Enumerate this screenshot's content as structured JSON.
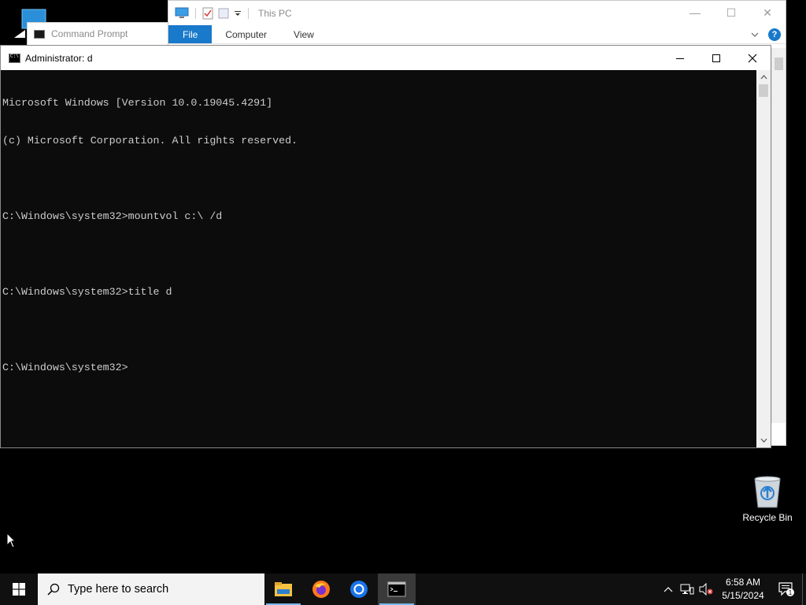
{
  "desktop": {
    "recycle_bin_label": "Recycle Bin"
  },
  "background_cmd": {
    "title": "Command Prompt"
  },
  "explorer": {
    "title": "This PC",
    "tabs": [
      "File",
      "Computer",
      "View"
    ],
    "accent": "#1979ca"
  },
  "cmd": {
    "title": "Administrator:  d",
    "lines": [
      "Microsoft Windows [Version 10.0.19045.4291]",
      "(c) Microsoft Corporation. All rights reserved.",
      "",
      "C:\\Windows\\system32>mountvol c:\\ /d",
      "",
      "C:\\Windows\\system32>title d",
      "",
      "C:\\Windows\\system32>"
    ],
    "text_color": "#cccccc",
    "background": "#0c0c0c"
  },
  "taskbar": {
    "search_placeholder": "Type here to search",
    "apps": [
      "file-explorer",
      "firefox",
      "chrome",
      "command-prompt"
    ],
    "clock_time": "6:58 AM",
    "clock_date": "5/15/2024",
    "notification_count": "1"
  }
}
